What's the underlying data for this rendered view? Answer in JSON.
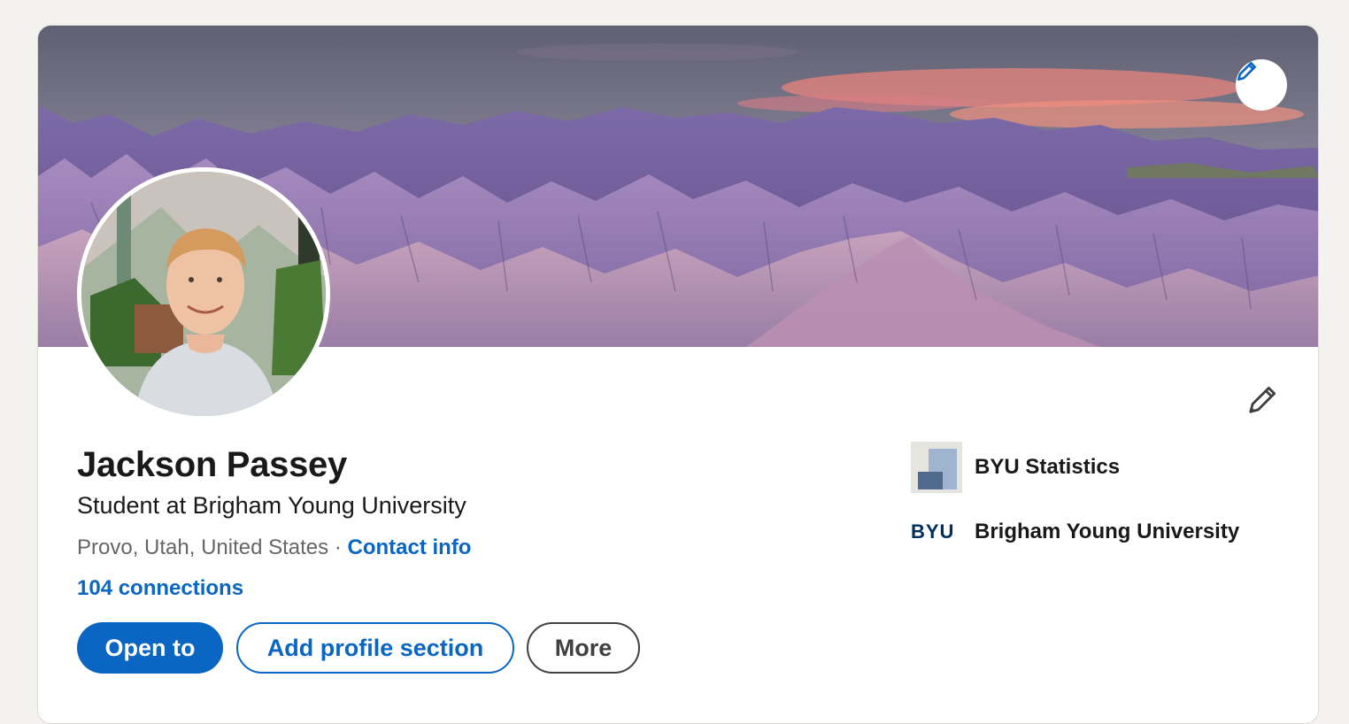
{
  "profile": {
    "name": "Jackson Passey",
    "headline": "Student at Brigham Young University",
    "location": "Provo, Utah, United States",
    "separator": " · ",
    "contact_info_label": "Contact info",
    "connections_label": "104 connections"
  },
  "actions": {
    "open_to_label": "Open to",
    "add_section_label": "Add profile section",
    "more_label": "More"
  },
  "organizations": [
    {
      "name": "BYU Statistics",
      "logo": "byu-statistics-logo"
    },
    {
      "name": "Brigham Young University",
      "logo_text": "BYU"
    }
  ],
  "icons": {
    "banner_edit": "pencil-icon",
    "intro_edit": "pencil-icon"
  },
  "colors": {
    "brand_blue": "#0a66c2",
    "page_background": "#f4f2ee",
    "text_primary": "#191919",
    "text_secondary": "#666666",
    "byu_navy": "#002e5d"
  }
}
